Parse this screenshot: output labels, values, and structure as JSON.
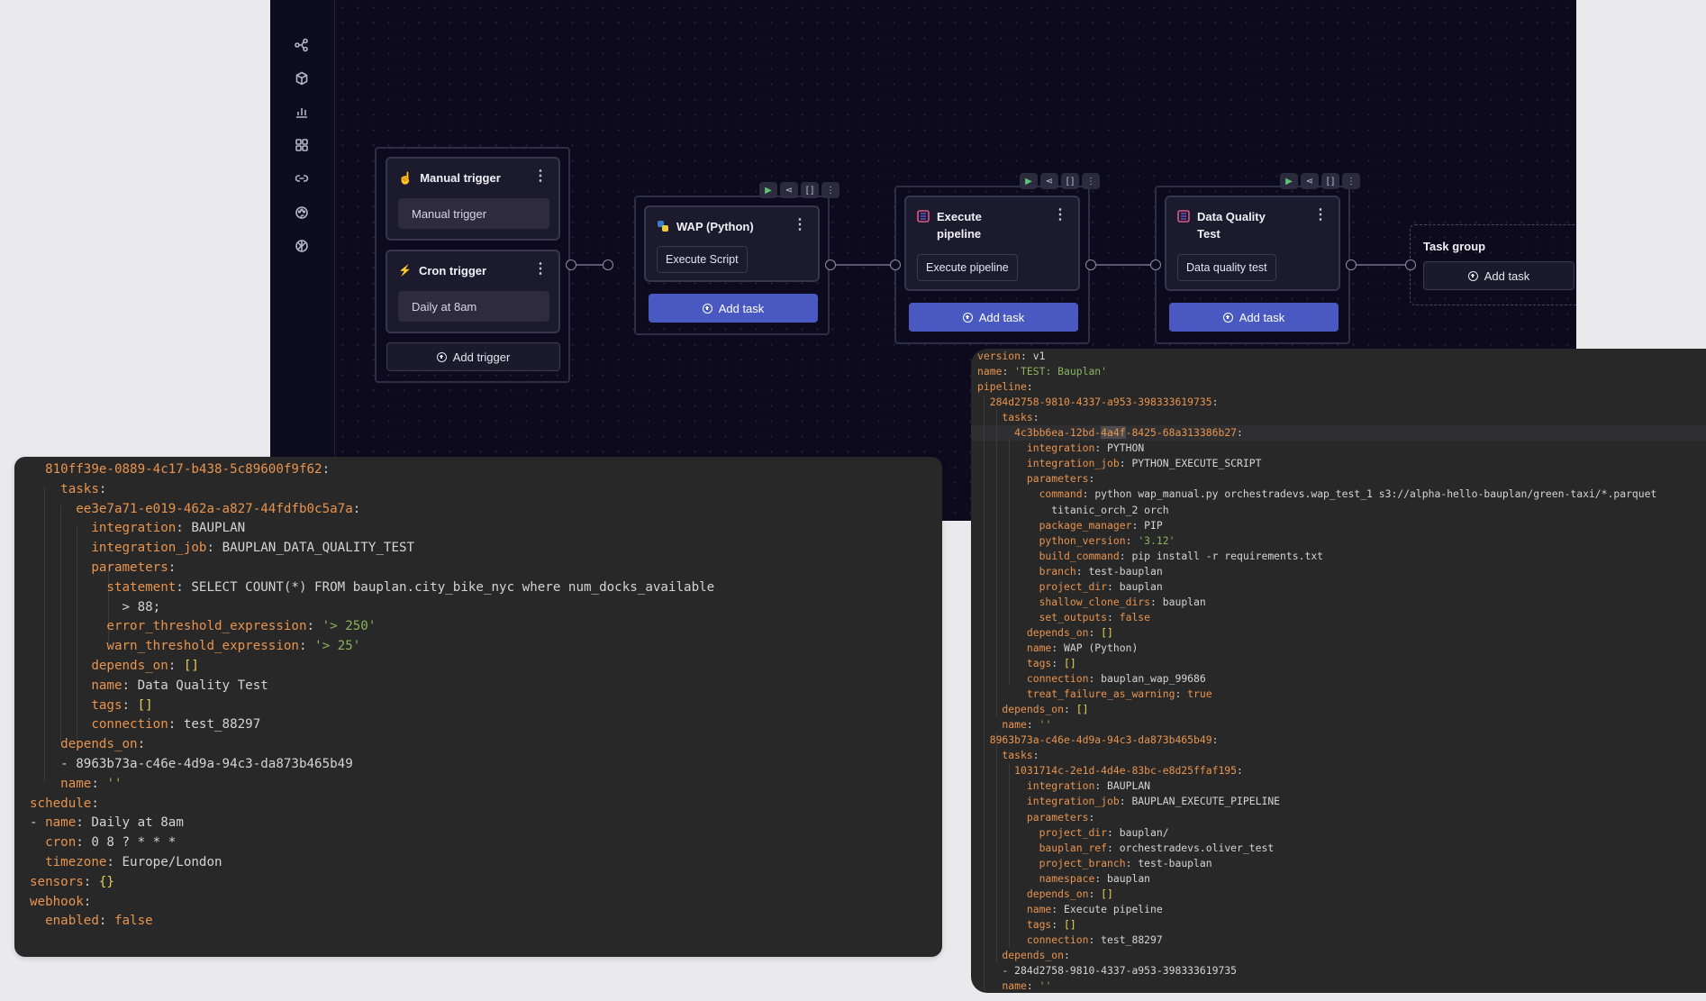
{
  "sidebar": {
    "items": [
      {
        "icon": "pipelines-icon"
      },
      {
        "icon": "box-icon"
      },
      {
        "icon": "bar-chart-icon"
      },
      {
        "icon": "grid-icon"
      },
      {
        "icon": "link-icon"
      },
      {
        "icon": "palette-icon"
      },
      {
        "icon": "brain-icon"
      }
    ]
  },
  "canvas": {
    "triggers": {
      "manual": {
        "title": "Manual trigger",
        "value": "Manual trigger"
      },
      "cron": {
        "title": "Cron trigger",
        "value": "Daily at 8am"
      },
      "add_label": "Add trigger"
    },
    "tasks": [
      {
        "title": "WAP (Python)",
        "chip": "Execute Script",
        "add_label": "Add task",
        "icon": "python-icon"
      },
      {
        "title": "Execute pipeline",
        "chip": "Execute pipeline",
        "add_label": "Add task",
        "icon": "bauplan-icon"
      },
      {
        "title": "Data Quality Test",
        "chip": "Data quality test",
        "add_label": "Add task",
        "icon": "bauplan-icon"
      }
    ],
    "task_group": {
      "title": "Task group",
      "add_label": "Add task"
    },
    "colors": {
      "accent": "#4a59c1",
      "background": "#0c0a1c",
      "node": "#1c1a2d"
    }
  },
  "yaml_left": [
    [
      [
        "k",
        "  810ff39e-0889-4c17-b438-5c89600f9f62"
      ],
      [
        "p",
        ":"
      ]
    ],
    [
      [
        "k",
        "    tasks"
      ],
      [
        "p",
        ":"
      ]
    ],
    [
      [
        "k",
        "      ee3e7a71-e019-462a-a827-44fdfb0c5a7a"
      ],
      [
        "p",
        ":"
      ]
    ],
    [
      [
        "k",
        "        integration"
      ],
      [
        "p",
        ": "
      ],
      [
        "v",
        "BAUPLAN"
      ]
    ],
    [
      [
        "k",
        "        integration_job"
      ],
      [
        "p",
        ": "
      ],
      [
        "v",
        "BAUPLAN_DATA_QUALITY_TEST"
      ]
    ],
    [
      [
        "k",
        "        parameters"
      ],
      [
        "p",
        ":"
      ]
    ],
    [
      [
        "k",
        "          statement"
      ],
      [
        "p",
        ": "
      ],
      [
        "v",
        "SELECT COUNT(*) FROM bauplan.city_bike_nyc where num_docks_available"
      ]
    ],
    [
      [
        "v",
        "            > 88;"
      ]
    ],
    [
      [
        "k",
        "          error_threshold_expression"
      ],
      [
        "p",
        ": "
      ],
      [
        "s",
        "'> 250'"
      ]
    ],
    [
      [
        "k",
        "          warn_threshold_expression"
      ],
      [
        "p",
        ": "
      ],
      [
        "s",
        "'> 25'"
      ]
    ],
    [
      [
        "k",
        "        depends_on"
      ],
      [
        "p",
        ": "
      ],
      [
        "b",
        "[]"
      ]
    ],
    [
      [
        "k",
        "        name"
      ],
      [
        "p",
        ": "
      ],
      [
        "v",
        "Data Quality Test"
      ]
    ],
    [
      [
        "k",
        "        tags"
      ],
      [
        "p",
        ": "
      ],
      [
        "b",
        "[]"
      ]
    ],
    [
      [
        "k",
        "        connection"
      ],
      [
        "p",
        ": "
      ],
      [
        "v",
        "test_88297"
      ]
    ],
    [
      [
        "k",
        "    depends_on"
      ],
      [
        "p",
        ":"
      ]
    ],
    [
      [
        "p",
        "    - "
      ],
      [
        "v",
        "8963b73a-c46e-4d9a-94c3-da873b465b49"
      ]
    ],
    [
      [
        "k",
        "    name"
      ],
      [
        "p",
        ": "
      ],
      [
        "s",
        "''"
      ]
    ],
    [
      [
        "k",
        "schedule"
      ],
      [
        "p",
        ":"
      ]
    ],
    [
      [
        "p",
        "- "
      ],
      [
        "k",
        "name"
      ],
      [
        "p",
        ": "
      ],
      [
        "v",
        "Daily at 8am"
      ]
    ],
    [
      [
        "k",
        "  cron"
      ],
      [
        "p",
        ": "
      ],
      [
        "v",
        "0 8 ? * * *"
      ]
    ],
    [
      [
        "k",
        "  timezone"
      ],
      [
        "p",
        ": "
      ],
      [
        "v",
        "Europe/London"
      ]
    ],
    [
      [
        "k",
        "sensors"
      ],
      [
        "p",
        ": "
      ],
      [
        "b",
        "{}"
      ]
    ],
    [
      [
        "k",
        "webhook"
      ],
      [
        "p",
        ":"
      ]
    ],
    [
      [
        "k",
        "  enabled"
      ],
      [
        "p",
        ": "
      ],
      [
        "k",
        "false"
      ]
    ]
  ],
  "yaml_right": [
    [
      [
        "k",
        "version"
      ],
      [
        "p",
        ": "
      ],
      [
        "v",
        "v1"
      ]
    ],
    [
      [
        "k",
        "name"
      ],
      [
        "p",
        ": "
      ],
      [
        "s",
        "'TEST: Bauplan'"
      ]
    ],
    [
      [
        "k",
        "pipeline"
      ],
      [
        "p",
        ":"
      ]
    ],
    [
      [
        "k",
        "  284d2758-9810-4337-a953-398333619735"
      ],
      [
        "p",
        ":"
      ]
    ],
    [
      [
        "k",
        "    tasks"
      ],
      [
        "p",
        ":"
      ]
    ],
    [
      [
        "k",
        "      4c3bb6ea-12bd-"
      ],
      [
        "sel",
        "4a4f"
      ],
      [
        "k",
        "-8425-68a313386b27"
      ],
      [
        "p",
        ":"
      ]
    ],
    [
      [
        "k",
        "        integration"
      ],
      [
        "p",
        ": "
      ],
      [
        "v",
        "PYTHON"
      ]
    ],
    [
      [
        "k",
        "        integration_job"
      ],
      [
        "p",
        ": "
      ],
      [
        "v",
        "PYTHON_EXECUTE_SCRIPT"
      ]
    ],
    [
      [
        "k",
        "        parameters"
      ],
      [
        "p",
        ":"
      ]
    ],
    [
      [
        "k",
        "          command"
      ],
      [
        "p",
        ": "
      ],
      [
        "v",
        "python wap_manual.py orchestradevs.wap_test_1 s3://alpha-hello-bauplan/green-taxi/*.parquet"
      ]
    ],
    [
      [
        "v",
        "            titanic_orch_2 orch"
      ]
    ],
    [
      [
        "k",
        "          package_manager"
      ],
      [
        "p",
        ": "
      ],
      [
        "v",
        "PIP"
      ]
    ],
    [
      [
        "k",
        "          python_version"
      ],
      [
        "p",
        ": "
      ],
      [
        "s",
        "'3.12'"
      ]
    ],
    [
      [
        "k",
        "          build_command"
      ],
      [
        "p",
        ": "
      ],
      [
        "v",
        "pip install -r requirements.txt"
      ]
    ],
    [
      [
        "k",
        "          branch"
      ],
      [
        "p",
        ": "
      ],
      [
        "v",
        "test-bauplan"
      ]
    ],
    [
      [
        "k",
        "          project_dir"
      ],
      [
        "p",
        ": "
      ],
      [
        "v",
        "bauplan"
      ]
    ],
    [
      [
        "k",
        "          shallow_clone_dirs"
      ],
      [
        "p",
        ": "
      ],
      [
        "v",
        "bauplan"
      ]
    ],
    [
      [
        "k",
        "          set_outputs"
      ],
      [
        "p",
        ": "
      ],
      [
        "k",
        "false"
      ]
    ],
    [
      [
        "k",
        "        depends_on"
      ],
      [
        "p",
        ": "
      ],
      [
        "b",
        "[]"
      ]
    ],
    [
      [
        "k",
        "        name"
      ],
      [
        "p",
        ": "
      ],
      [
        "v",
        "WAP (Python)"
      ]
    ],
    [
      [
        "k",
        "        tags"
      ],
      [
        "p",
        ": "
      ],
      [
        "b",
        "[]"
      ]
    ],
    [
      [
        "k",
        "        connection"
      ],
      [
        "p",
        ": "
      ],
      [
        "v",
        "bauplan_wap_99686"
      ]
    ],
    [
      [
        "k",
        "        treat_failure_as_warning"
      ],
      [
        "p",
        ": "
      ],
      [
        "k",
        "true"
      ]
    ],
    [
      [
        "k",
        "    depends_on"
      ],
      [
        "p",
        ": "
      ],
      [
        "b",
        "[]"
      ]
    ],
    [
      [
        "k",
        "    name"
      ],
      [
        "p",
        ": "
      ],
      [
        "s",
        "''"
      ]
    ],
    [
      [
        "k",
        "  8963b73a-c46e-4d9a-94c3-da873b465b49"
      ],
      [
        "p",
        ":"
      ]
    ],
    [
      [
        "k",
        "    tasks"
      ],
      [
        "p",
        ":"
      ]
    ],
    [
      [
        "k",
        "      1031714c-2e1d-4d4e-83bc-e8d25ffaf195"
      ],
      [
        "p",
        ":"
      ]
    ],
    [
      [
        "k",
        "        integration"
      ],
      [
        "p",
        ": "
      ],
      [
        "v",
        "BAUPLAN"
      ]
    ],
    [
      [
        "k",
        "        integration_job"
      ],
      [
        "p",
        ": "
      ],
      [
        "v",
        "BAUPLAN_EXECUTE_PIPELINE"
      ]
    ],
    [
      [
        "k",
        "        parameters"
      ],
      [
        "p",
        ":"
      ]
    ],
    [
      [
        "k",
        "          project_dir"
      ],
      [
        "p",
        ": "
      ],
      [
        "v",
        "bauplan/"
      ]
    ],
    [
      [
        "k",
        "          bauplan_ref"
      ],
      [
        "p",
        ": "
      ],
      [
        "v",
        "orchestradevs.oliver_test"
      ]
    ],
    [
      [
        "k",
        "          project_branch"
      ],
      [
        "p",
        ": "
      ],
      [
        "v",
        "test-bauplan"
      ]
    ],
    [
      [
        "k",
        "          namespace"
      ],
      [
        "p",
        ": "
      ],
      [
        "v",
        "bauplan"
      ]
    ],
    [
      [
        "k",
        "        depends_on"
      ],
      [
        "p",
        ": "
      ],
      [
        "b",
        "[]"
      ]
    ],
    [
      [
        "k",
        "        name"
      ],
      [
        "p",
        ": "
      ],
      [
        "v",
        "Execute pipeline"
      ]
    ],
    [
      [
        "k",
        "        tags"
      ],
      [
        "p",
        ": "
      ],
      [
        "b",
        "[]"
      ]
    ],
    [
      [
        "k",
        "        connection"
      ],
      [
        "p",
        ": "
      ],
      [
        "v",
        "test_88297"
      ]
    ],
    [
      [
        "k",
        "    depends_on"
      ],
      [
        "p",
        ":"
      ]
    ],
    [
      [
        "p",
        "    - "
      ],
      [
        "v",
        "284d2758-9810-4337-a953-398333619735"
      ]
    ],
    [
      [
        "k",
        "    name"
      ],
      [
        "p",
        ": "
      ],
      [
        "s",
        "''"
      ]
    ]
  ]
}
